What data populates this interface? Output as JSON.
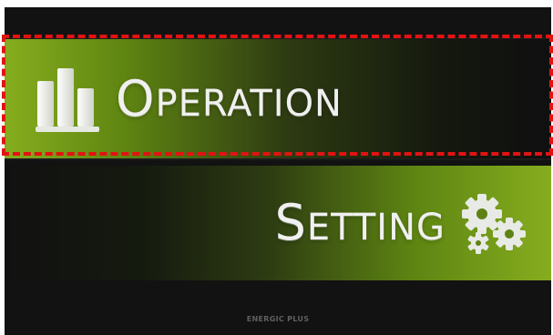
{
  "menu": {
    "operation": {
      "label": "OPERATION",
      "icon": "bar-chart-icon"
    },
    "setting": {
      "label": "SETTING",
      "icon": "gears-icon"
    }
  },
  "footer": {
    "brand": "ENERGIC PLUS"
  },
  "colors": {
    "accent_green": "#86ad1e",
    "background": "#121212",
    "focus_outline": "#e31212",
    "label_text": "#f0f0f0"
  }
}
